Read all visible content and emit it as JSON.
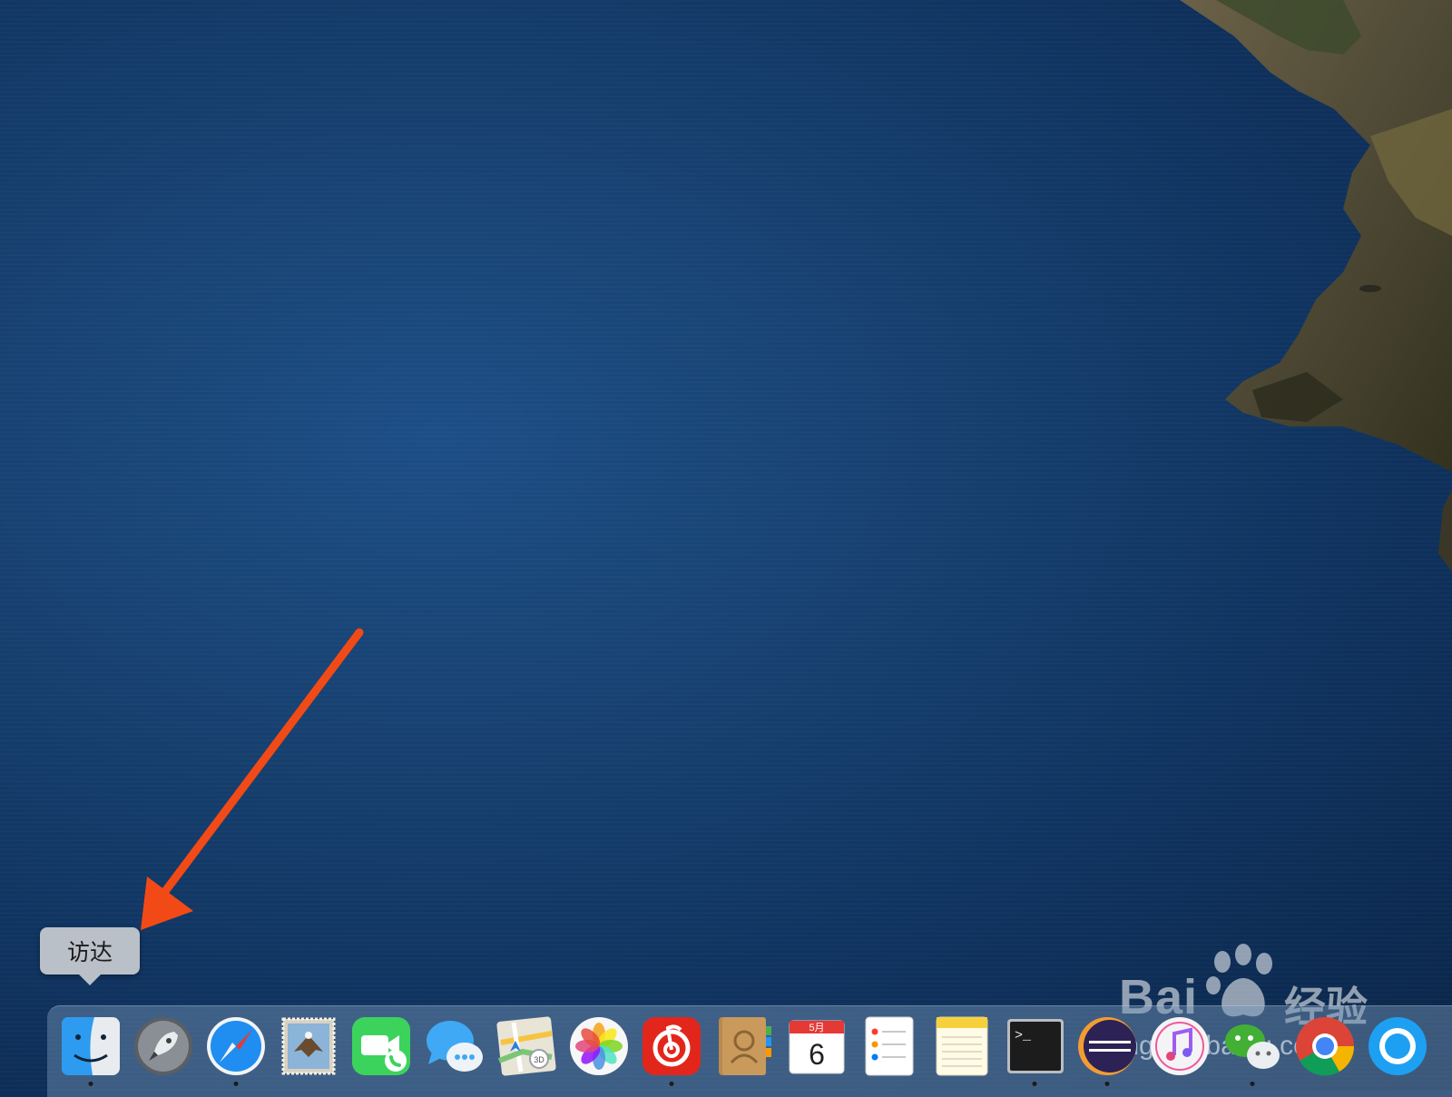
{
  "tooltip": {
    "text": "访达"
  },
  "watermark": {
    "brand": "Bai",
    "brand_cn": "经验",
    "url": "jingyan.baidu.com"
  },
  "calendar": {
    "month": "5月",
    "day": "6"
  },
  "terminal": {
    "prompt": ">_"
  },
  "dock": {
    "items": [
      {
        "name": "finder-icon",
        "running": true
      },
      {
        "name": "launchpad-icon",
        "running": false
      },
      {
        "name": "safari-icon",
        "running": true
      },
      {
        "name": "mail-icon",
        "running": false
      },
      {
        "name": "facetime-icon",
        "running": false
      },
      {
        "name": "messages-icon",
        "running": false
      },
      {
        "name": "maps-icon",
        "running": false
      },
      {
        "name": "photos-icon",
        "running": false
      },
      {
        "name": "netease-music-icon",
        "running": true
      },
      {
        "name": "contacts-icon",
        "running": false
      },
      {
        "name": "calendar-icon",
        "running": false
      },
      {
        "name": "reminders-icon",
        "running": false
      },
      {
        "name": "notes-icon",
        "running": false
      },
      {
        "name": "terminal-icon",
        "running": true
      },
      {
        "name": "eclipse-icon",
        "running": true
      },
      {
        "name": "itunes-icon",
        "running": false
      },
      {
        "name": "wechat-icon",
        "running": true
      },
      {
        "name": "chrome-icon",
        "running": false
      },
      {
        "name": "qq-icon",
        "running": false
      }
    ]
  }
}
